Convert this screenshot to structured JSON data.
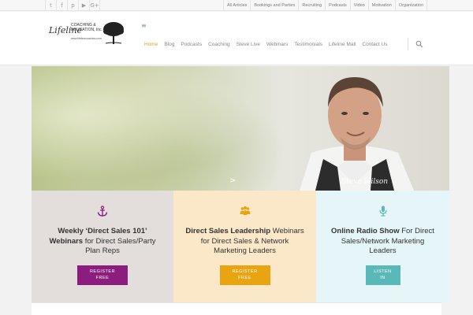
{
  "social": {
    "icons": [
      "twitter-icon",
      "facebook-icon",
      "pinterest-icon",
      "youtube-icon",
      "google-plus-icon"
    ],
    "glyphs": [
      "t",
      "f",
      "p",
      "▶",
      "G+"
    ]
  },
  "toplinks": [
    "All Articles",
    "Bookings and Parties",
    "Recruiting",
    "Podcasts",
    "Video",
    "Motivation",
    "Organization"
  ],
  "logo": {
    "script": "Lifeline",
    "sub": "COACHING & EDUCATION, Inc.",
    "url": "www.lifelinecoaches.com"
  },
  "nav": {
    "items": [
      "Home",
      "Blog",
      "Podcasts",
      "Coaching",
      "Steve Live",
      "Webinars",
      "Testimonials",
      "Lifeline Mall",
      "Contact Us"
    ],
    "active": "Home"
  },
  "hero": {
    "signature": "Steve Wilson",
    "arrow": ">"
  },
  "panels": [
    {
      "icon": "anchor-icon",
      "color": "#8a1d7d",
      "bold": "Weekly ‘Direct Sales 101’ Webinars",
      "rest": " for Direct Sales/Party Plan Reps",
      "button_line1": "REGISTER",
      "button_line2": "FREE"
    },
    {
      "icon": "people-icon",
      "color": "#e9a411",
      "bold": "Direct Sales Leadership",
      "rest": " Webinars for Direct Sales & Network Marketing Leaders",
      "button_line1": "REGISTER",
      "button_line2": "FREE"
    },
    {
      "icon": "microphone-icon",
      "color": "#5bb8b9",
      "bold": "Online Radio Show",
      "rest": " For Direct Sales/Network Marketing Leaders",
      "button_line1": "LISTEN",
      "button_line2": "IN"
    }
  ]
}
